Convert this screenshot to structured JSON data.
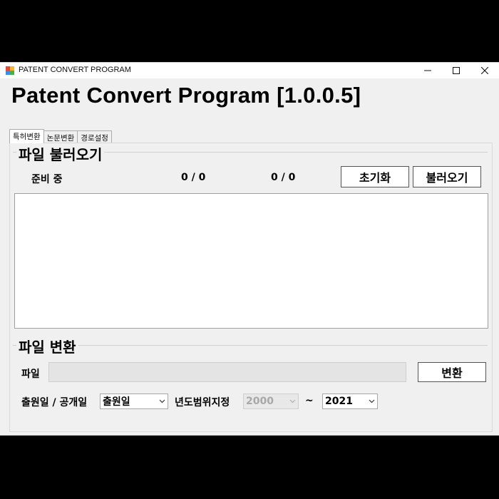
{
  "window": {
    "title": "PATENT CONVERT PROGRAM",
    "minimize_icon": "minimize-icon",
    "maximize_icon": "maximize-icon",
    "close_icon": "close-icon"
  },
  "heading": "Patent Convert Program [1.0.0.5]",
  "tabs": [
    {
      "label": "특허변환",
      "active": true
    },
    {
      "label": "논문변환",
      "active": false
    },
    {
      "label": "경로설정",
      "active": false
    }
  ],
  "load_section": {
    "title": "파일 불러오기",
    "status": "준비 중",
    "count1": "0 / 0",
    "count2": "0 / 0",
    "reset_button": "초기화",
    "load_button": "불러오기"
  },
  "convert_section": {
    "title": "파일 변환",
    "file_label": "파일",
    "file_value": "",
    "convert_button": "변환",
    "date_type_label": "출원일 / 공개일",
    "date_type_value": "출원일",
    "year_range_label": "년도범위지정",
    "year_from": "2000",
    "tilde": "~",
    "year_to": "2021"
  },
  "colors": {
    "window_bg": "#f0f0f0",
    "titlebar_bg": "#ffffff",
    "list_bg": "#ffffff",
    "disabled_text": "#a8a8a8"
  }
}
